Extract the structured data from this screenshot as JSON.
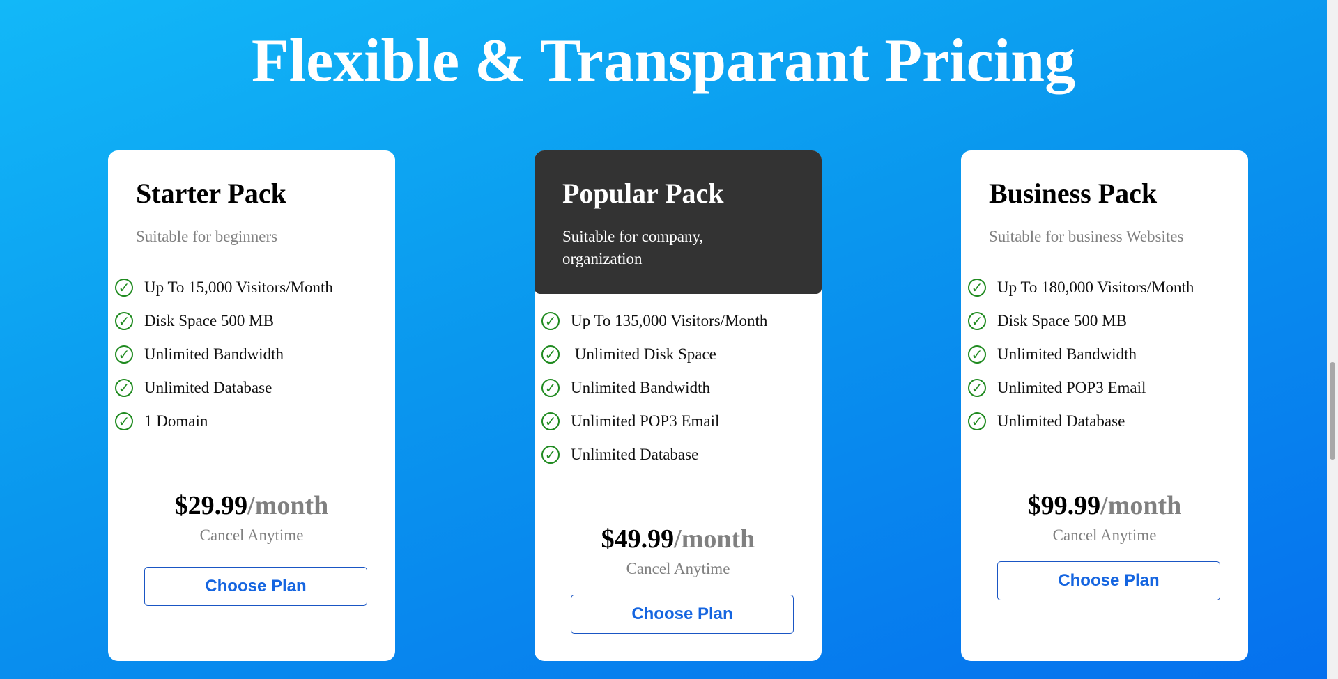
{
  "page": {
    "title": "Flexible & Transparant Pricing"
  },
  "plans": [
    {
      "name": "Starter Pack",
      "description": "Suitable for beginners",
      "features": [
        "Up To 15,000 Visitors/Month",
        "Disk Space 500 MB",
        "Unlimited Bandwidth",
        "Unlimited Database",
        "1 Domain"
      ],
      "price": "$29.99",
      "period": "/month",
      "cancel_text": "Cancel Anytime",
      "button_label": "Choose Plan"
    },
    {
      "name": "Popular Pack",
      "description": "Suitable for company, organization",
      "features": [
        "Up To 135,000 Visitors/Month",
        " Unlimited Disk Space",
        "Unlimited Bandwidth",
        "Unlimited POP3 Email",
        "Unlimited Database"
      ],
      "price": "$49.99",
      "period": "/month",
      "cancel_text": "Cancel Anytime",
      "button_label": "Choose Plan"
    },
    {
      "name": "Business Pack",
      "description": "Suitable for business Websites",
      "features": [
        "Up To 180,000 Visitors/Month",
        "Disk Space 500 MB",
        "Unlimited Bandwidth",
        "Unlimited POP3 Email",
        "Unlimited Database"
      ],
      "price": "$99.99",
      "period": "/month",
      "cancel_text": "Cancel Anytime",
      "button_label": "Choose Plan"
    }
  ],
  "icons": {
    "check": "check-circle-icon",
    "check_color": "#1f8a1f"
  },
  "colors": {
    "background_start": "#12b8f8",
    "background_end": "#0570ee",
    "popular_header": "#333333",
    "button_text": "#1565e0"
  }
}
